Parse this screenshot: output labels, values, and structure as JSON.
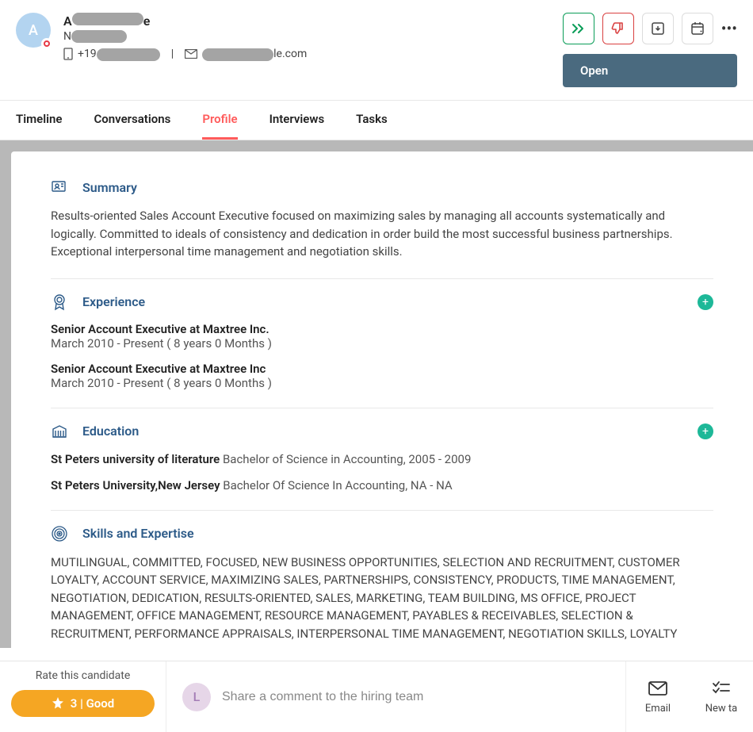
{
  "candidate": {
    "avatar_letter": "A",
    "name_prefix": "A",
    "name_suffix": "e",
    "phone_prefix": "+19",
    "email_suffix": "le.com"
  },
  "status": {
    "label": "Open"
  },
  "tabs": {
    "timeline": "Timeline",
    "conversations": "Conversations",
    "profile": "Profile",
    "interviews": "Interviews",
    "tasks": "Tasks"
  },
  "sections": {
    "summary": {
      "title": "Summary",
      "body": "Results-oriented Sales Account Executive focused on maximizing sales by managing all accounts systematically and logically. Committed to ideals of consistency and dedication in order build the most successful business partnerships. Exceptional interpersonal time management and negotiation skills."
    },
    "experience": {
      "title": "Experience",
      "items": [
        {
          "title": "Senior Account Executive at Maxtree Inc.",
          "dates": "March 2010 - Present ( 8 years 0 Months )"
        },
        {
          "title": "Senior Account Executive at Maxtree Inc",
          "dates": "March 2010 - Present ( 8 years 0 Months )"
        }
      ]
    },
    "education": {
      "title": "Education",
      "items": [
        {
          "school": "St Peters university of literature",
          "degree": " Bachelor of Science in Accounting, 2005 - 2009"
        },
        {
          "school": "St Peters University,New Jersey",
          "degree": " Bachelor Of Science In Accounting, NA - NA"
        }
      ]
    },
    "skills": {
      "title": "Skills and Expertise",
      "body": "MUTILINGUAL, COMMITTED, FOCUSED, NEW BUSINESS OPPORTUNITIES, SELECTION AND RECRUITMENT, CUSTOMER LOYALTY, ACCOUNT SERVICE, MAXIMIZING SALES, PARTNERSHIPS, CONSISTENCY, PRODUCTS, TIME MANAGEMENT, NEGOTIATION, DEDICATION, RESULTS-ORIENTED, SALES, MARKETING, TEAM BUILDING, MS OFFICE, PROJECT MANAGEMENT, OFFICE MANAGEMENT, RESOURCE MANAGEMENT, PAYABLES & RECEIVABLES, SELECTION & RECRUITMENT, PERFORMANCE APPRAISALS, INTERPERSONAL TIME MANAGEMENT, NEGOTIATION SKILLS, LOYALTY"
    }
  },
  "footer": {
    "rating_label": "Rate this candidate",
    "rating_value": "3 | Good",
    "comment_avatar": "L",
    "comment_placeholder": "Share a comment to the hiring team",
    "email_label": "Email",
    "newtask_label": "New ta"
  }
}
